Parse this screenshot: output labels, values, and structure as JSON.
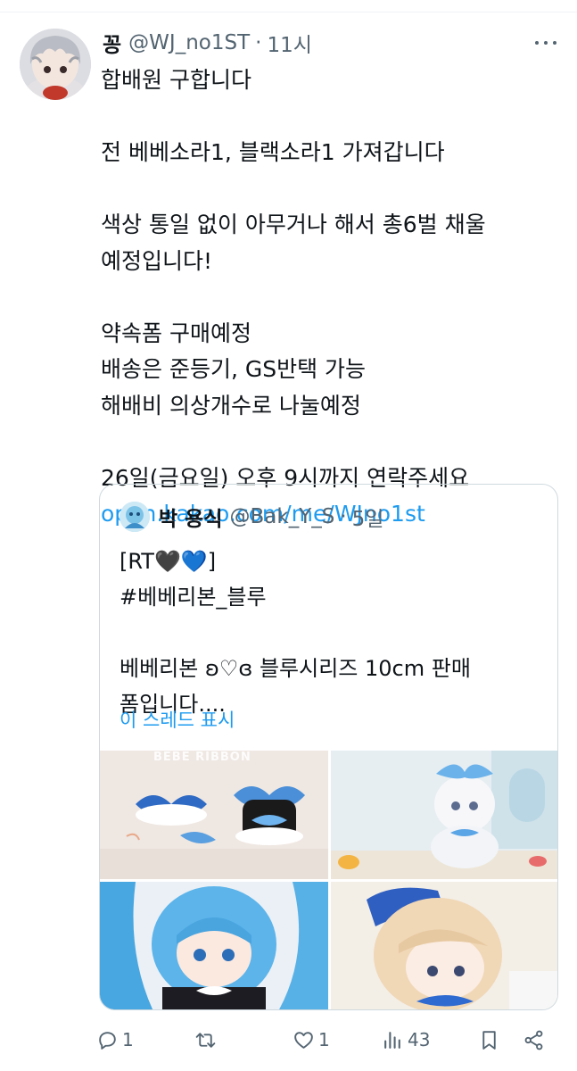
{
  "tweet": {
    "author_name": "꽁",
    "author_handle": "@WJ_no1ST",
    "separator": "·",
    "time": "11시",
    "lines": [
      "합배원 구합니다",
      "",
      "전 베베소라1, 블랙소라1 가져갑니다",
      "",
      "색상 통일 없이 아무거나 해서 총6벌 채울",
      "예정입니다!",
      "",
      "약속폼 구매예정",
      "배송은 준등기, GS반택 가능",
      "해배비 의상개수로 나눌예정",
      "",
      "26일(금요일) 오후 9시까지 연락주세요"
    ],
    "link": "open.kakao.com/me/WJno1st"
  },
  "quote": {
    "author_name": "박 용식",
    "author_handle": "@Bak_Y_S",
    "separator": "·",
    "time": "5일",
    "lines": [
      "[RT🖤💙]",
      "#베베리본_블루",
      "",
      "베베리본 ʚ♡ɞ 블루시리즈 10cm 판매",
      "폼입니다...."
    ],
    "show_thread": "이 스레드 표시",
    "image_label": "BEBE RIBBON"
  },
  "actions": {
    "reply_count": "1",
    "retweet_count": "",
    "like_count": "1",
    "view_count": "43"
  },
  "colors": {
    "text": "#0f1419",
    "secondary": "#536471",
    "link": "#1d9bf0",
    "border": "#cfd9de"
  }
}
